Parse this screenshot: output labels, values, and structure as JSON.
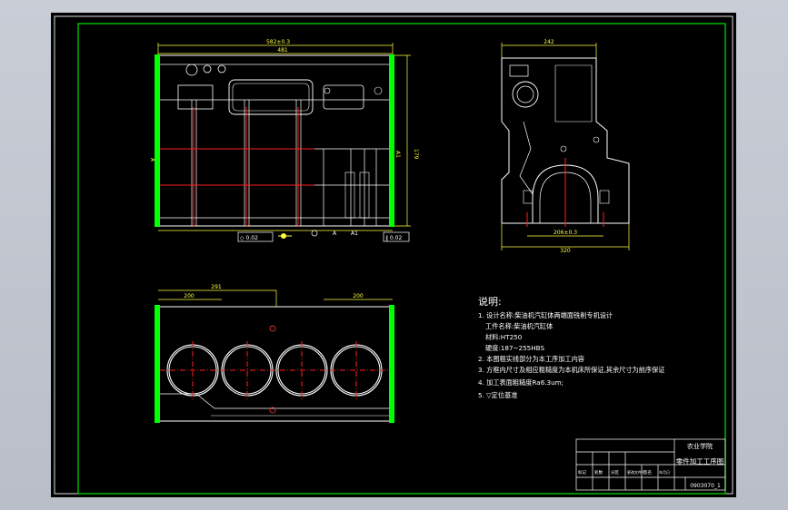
{
  "drawing": {
    "notes_title": "说明:",
    "notes": [
      "1. 设计名称:柴油机汽缸体两端面铣削专机设计",
      "工件名称:柴油机汽缸体",
      "材料:HT250",
      "硬度:187~255HBS",
      "2. 本图粗实线部分为本工序加工内容",
      "3. 方框内尺寸及相应粗糙度为本机床所保证,其余尺寸为前序保证",
      "4. 加工表面粗糙度Ra6.3um;",
      "5. ▽定位基准"
    ],
    "dims_front": {
      "overall_width": "582±0.3",
      "inner_width": "481",
      "height": "179",
      "left_label": "A",
      "right_label": "A1",
      "flatness": "◇ 0.02",
      "parallel": "∥ 0.02",
      "bottom_a": "A",
      "bottom_a1": "A1"
    },
    "dims_side": {
      "top_width": "242",
      "bore_width": "206±0.3",
      "overall_width": "320"
    },
    "dims_bottom": {
      "left_span": "291",
      "left_inner": "200",
      "right_inner": "200"
    },
    "title_block": {
      "school": "农业学院",
      "drawing_title": "零件加工工序图",
      "drawing_no": "0903070_1",
      "header_cells": [
        "标记",
        "处数",
        "分区",
        "更改文件号",
        "签名",
        "年月日"
      ]
    },
    "colors": {
      "frame": "#00e600",
      "outline": "#ffffff",
      "centerline": "#ff2020",
      "dimension": "#ffff40",
      "machined_face": "#00ff00"
    }
  }
}
